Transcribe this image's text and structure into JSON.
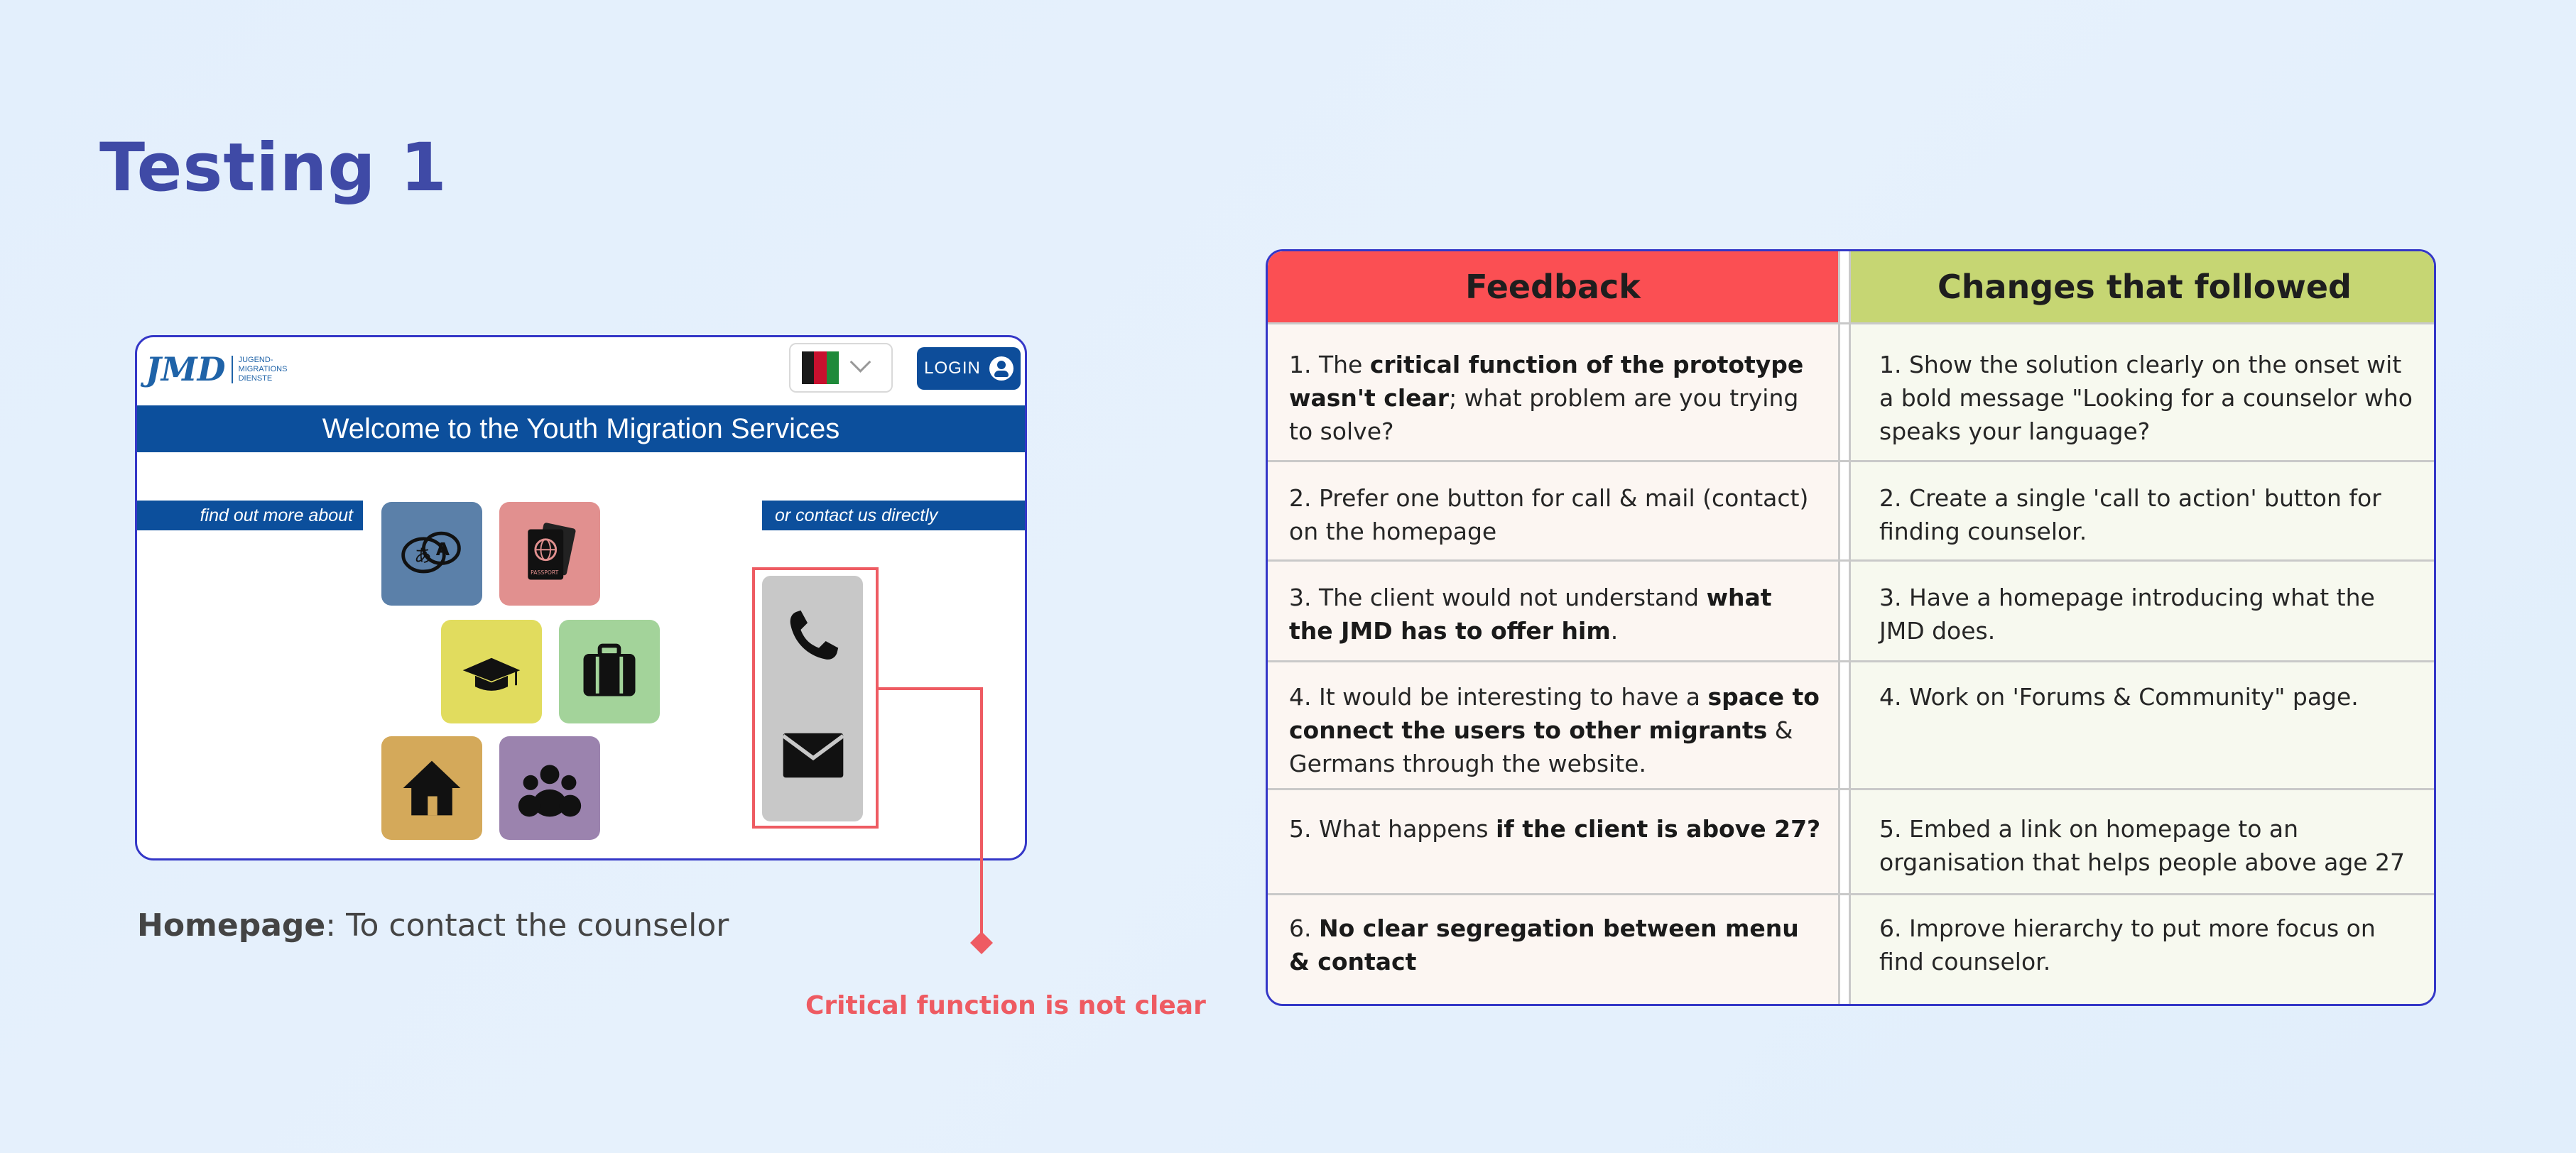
{
  "page": {
    "title": "Testing 1"
  },
  "prototype": {
    "logo": {
      "mark": "JMD",
      "sub_lines": [
        "JUGEND-",
        "MIGRATIONS",
        "DIENSTE"
      ]
    },
    "language_selector": {
      "flag": "afghanistan-flag"
    },
    "login_label": "LOGIN",
    "banner_text": "Welcome to the Youth Migration Services",
    "left_tag": "find out more about",
    "right_tag": "or contact us directly",
    "tiles": [
      {
        "icon": "translation-icon",
        "color": "#5b80a9"
      },
      {
        "icon": "passport-icon",
        "color": "#e1908f"
      },
      {
        "icon": "graduation-cap-icon",
        "color": "#e1dc5e"
      },
      {
        "icon": "briefcase-icon",
        "color": "#a3d39a"
      },
      {
        "icon": "house-icon",
        "color": "#d4a95a"
      },
      {
        "icon": "group-icon",
        "color": "#9b83ae"
      }
    ],
    "contact": {
      "icons": [
        "phone-icon",
        "mail-icon"
      ],
      "box_color": "#c8c8c8",
      "highlight_color": "#ee5b62"
    }
  },
  "caption": {
    "bold": "Homepage",
    "rest": ": To contact the counselor"
  },
  "annotation": "Critical function is not clear",
  "table": {
    "headers": {
      "feedback": "Feedback",
      "changes": "Changes that followed"
    },
    "colors": {
      "feedback_header": "#fb4f53",
      "changes_header": "#c6d673"
    },
    "rows": [
      {
        "feedback": [
          {
            "t": "1. The ",
            "b": false
          },
          {
            "t": "critical function of the prototype wasn't clear",
            "b": true
          },
          {
            "t": "; what problem are you trying to solve?",
            "b": false
          }
        ],
        "change": "1. Show the solution clearly on the onset wit a bold message \"Looking for a counselor who speaks your language?"
      },
      {
        "feedback": [
          {
            "t": "2. Prefer one button for call & mail (contact) on the homepage",
            "b": false
          }
        ],
        "change": "2. Create a single 'call to action' button for finding counselor."
      },
      {
        "feedback": [
          {
            "t": "3. The client would not understand ",
            "b": false
          },
          {
            "t": "what the JMD has to offer him",
            "b": true
          },
          {
            "t": ".",
            "b": false
          }
        ],
        "change": "3. Have a homepage introducing what the JMD does."
      },
      {
        "feedback": [
          {
            "t": "4. It would be interesting to have a ",
            "b": false
          },
          {
            "t": "space to connect the users to other migrants",
            "b": true
          },
          {
            "t": " & Germans through the website.",
            "b": false
          }
        ],
        "change": "4. Work on 'Forums & Community\" page."
      },
      {
        "feedback": [
          {
            "t": "5. What happens ",
            "b": false
          },
          {
            "t": "if the client is above 27?",
            "b": true
          }
        ],
        "change": "5. Embed a link on homepage to an organisation that helps people above age 27"
      },
      {
        "feedback": [
          {
            "t": "6. ",
            "b": false
          },
          {
            "t": "No clear segregation between menu & contact",
            "b": true
          }
        ],
        "change": "6. Improve hierarchy to put more focus on find counselor."
      }
    ]
  }
}
